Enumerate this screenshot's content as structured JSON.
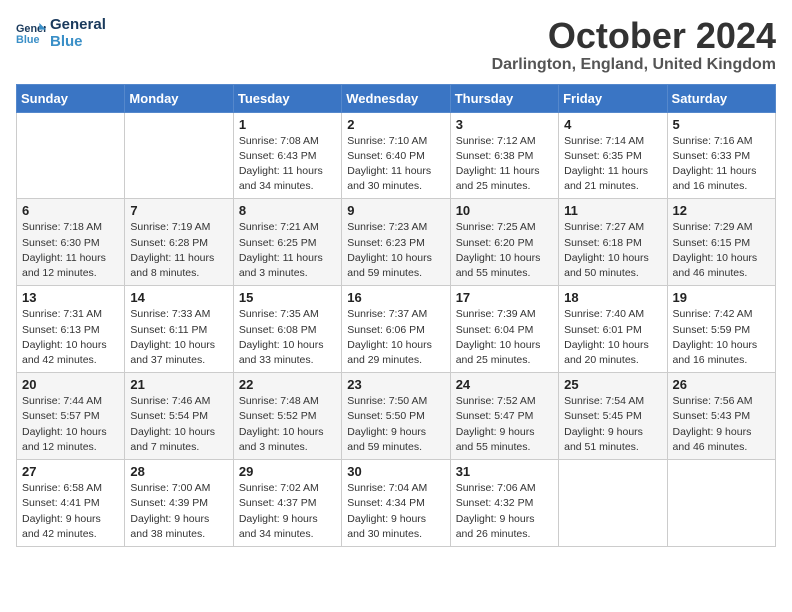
{
  "header": {
    "logo_line1": "General",
    "logo_line2": "Blue",
    "title": "October 2024",
    "location": "Darlington, England, United Kingdom"
  },
  "weekdays": [
    "Sunday",
    "Monday",
    "Tuesday",
    "Wednesday",
    "Thursday",
    "Friday",
    "Saturday"
  ],
  "weeks": [
    [
      {
        "day": "",
        "info": ""
      },
      {
        "day": "",
        "info": ""
      },
      {
        "day": "1",
        "info": "Sunrise: 7:08 AM\nSunset: 6:43 PM\nDaylight: 11 hours\nand 34 minutes."
      },
      {
        "day": "2",
        "info": "Sunrise: 7:10 AM\nSunset: 6:40 PM\nDaylight: 11 hours\nand 30 minutes."
      },
      {
        "day": "3",
        "info": "Sunrise: 7:12 AM\nSunset: 6:38 PM\nDaylight: 11 hours\nand 25 minutes."
      },
      {
        "day": "4",
        "info": "Sunrise: 7:14 AM\nSunset: 6:35 PM\nDaylight: 11 hours\nand 21 minutes."
      },
      {
        "day": "5",
        "info": "Sunrise: 7:16 AM\nSunset: 6:33 PM\nDaylight: 11 hours\nand 16 minutes."
      }
    ],
    [
      {
        "day": "6",
        "info": "Sunrise: 7:18 AM\nSunset: 6:30 PM\nDaylight: 11 hours\nand 12 minutes."
      },
      {
        "day": "7",
        "info": "Sunrise: 7:19 AM\nSunset: 6:28 PM\nDaylight: 11 hours\nand 8 minutes."
      },
      {
        "day": "8",
        "info": "Sunrise: 7:21 AM\nSunset: 6:25 PM\nDaylight: 11 hours\nand 3 minutes."
      },
      {
        "day": "9",
        "info": "Sunrise: 7:23 AM\nSunset: 6:23 PM\nDaylight: 10 hours\nand 59 minutes."
      },
      {
        "day": "10",
        "info": "Sunrise: 7:25 AM\nSunset: 6:20 PM\nDaylight: 10 hours\nand 55 minutes."
      },
      {
        "day": "11",
        "info": "Sunrise: 7:27 AM\nSunset: 6:18 PM\nDaylight: 10 hours\nand 50 minutes."
      },
      {
        "day": "12",
        "info": "Sunrise: 7:29 AM\nSunset: 6:15 PM\nDaylight: 10 hours\nand 46 minutes."
      }
    ],
    [
      {
        "day": "13",
        "info": "Sunrise: 7:31 AM\nSunset: 6:13 PM\nDaylight: 10 hours\nand 42 minutes."
      },
      {
        "day": "14",
        "info": "Sunrise: 7:33 AM\nSunset: 6:11 PM\nDaylight: 10 hours\nand 37 minutes."
      },
      {
        "day": "15",
        "info": "Sunrise: 7:35 AM\nSunset: 6:08 PM\nDaylight: 10 hours\nand 33 minutes."
      },
      {
        "day": "16",
        "info": "Sunrise: 7:37 AM\nSunset: 6:06 PM\nDaylight: 10 hours\nand 29 minutes."
      },
      {
        "day": "17",
        "info": "Sunrise: 7:39 AM\nSunset: 6:04 PM\nDaylight: 10 hours\nand 25 minutes."
      },
      {
        "day": "18",
        "info": "Sunrise: 7:40 AM\nSunset: 6:01 PM\nDaylight: 10 hours\nand 20 minutes."
      },
      {
        "day": "19",
        "info": "Sunrise: 7:42 AM\nSunset: 5:59 PM\nDaylight: 10 hours\nand 16 minutes."
      }
    ],
    [
      {
        "day": "20",
        "info": "Sunrise: 7:44 AM\nSunset: 5:57 PM\nDaylight: 10 hours\nand 12 minutes."
      },
      {
        "day": "21",
        "info": "Sunrise: 7:46 AM\nSunset: 5:54 PM\nDaylight: 10 hours\nand 7 minutes."
      },
      {
        "day": "22",
        "info": "Sunrise: 7:48 AM\nSunset: 5:52 PM\nDaylight: 10 hours\nand 3 minutes."
      },
      {
        "day": "23",
        "info": "Sunrise: 7:50 AM\nSunset: 5:50 PM\nDaylight: 9 hours\nand 59 minutes."
      },
      {
        "day": "24",
        "info": "Sunrise: 7:52 AM\nSunset: 5:47 PM\nDaylight: 9 hours\nand 55 minutes."
      },
      {
        "day": "25",
        "info": "Sunrise: 7:54 AM\nSunset: 5:45 PM\nDaylight: 9 hours\nand 51 minutes."
      },
      {
        "day": "26",
        "info": "Sunrise: 7:56 AM\nSunset: 5:43 PM\nDaylight: 9 hours\nand 46 minutes."
      }
    ],
    [
      {
        "day": "27",
        "info": "Sunrise: 6:58 AM\nSunset: 4:41 PM\nDaylight: 9 hours\nand 42 minutes."
      },
      {
        "day": "28",
        "info": "Sunrise: 7:00 AM\nSunset: 4:39 PM\nDaylight: 9 hours\nand 38 minutes."
      },
      {
        "day": "29",
        "info": "Sunrise: 7:02 AM\nSunset: 4:37 PM\nDaylight: 9 hours\nand 34 minutes."
      },
      {
        "day": "30",
        "info": "Sunrise: 7:04 AM\nSunset: 4:34 PM\nDaylight: 9 hours\nand 30 minutes."
      },
      {
        "day": "31",
        "info": "Sunrise: 7:06 AM\nSunset: 4:32 PM\nDaylight: 9 hours\nand 26 minutes."
      },
      {
        "day": "",
        "info": ""
      },
      {
        "day": "",
        "info": ""
      }
    ]
  ]
}
